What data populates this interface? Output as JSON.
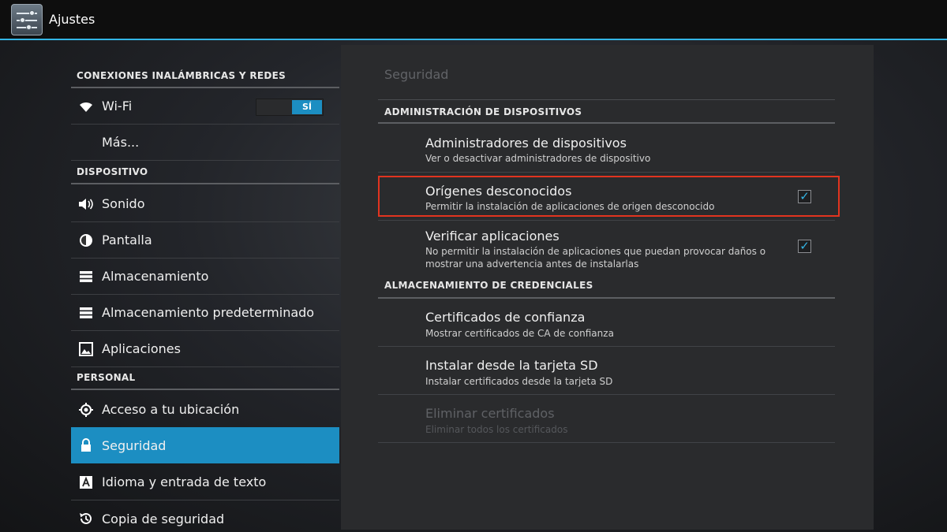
{
  "action_bar": {
    "title": "Ajustes",
    "icon": "settings-sliders-icon"
  },
  "left": {
    "sections": [
      {
        "header": "CONEXIONES INALÁMBRICAS Y REDES"
      },
      {
        "header": "DISPOSITIVO"
      },
      {
        "header": "PERSONAL"
      }
    ],
    "items": [
      {
        "label": "Wi-Fi",
        "icon": "wifi-icon",
        "toggle": "SÍ"
      },
      {
        "label": "Más..."
      },
      {
        "label": "Sonido",
        "icon": "speaker-icon"
      },
      {
        "label": "Pantalla",
        "icon": "brightness-icon"
      },
      {
        "label": "Almacenamiento",
        "icon": "storage-icon"
      },
      {
        "label": "Almacenamiento predeterminado",
        "icon": "storage-icon"
      },
      {
        "label": "Aplicaciones",
        "icon": "apps-icon"
      },
      {
        "label": "Acceso a tu ubicación",
        "icon": "location-icon"
      },
      {
        "label": "Seguridad",
        "icon": "lock-icon",
        "selected": true
      },
      {
        "label": "Idioma y entrada de texto",
        "icon": "language-icon"
      },
      {
        "label": "Copia de seguridad",
        "icon": "backup-icon"
      }
    ]
  },
  "right": {
    "title": "Seguridad",
    "sections": [
      {
        "header": "ADMINISTRACIÓN DE DISPOSITIVOS"
      },
      {
        "header": "ALMACENAMIENTO DE CREDENCIALES"
      }
    ],
    "prefs": [
      {
        "title": "Administradores de dispositivos",
        "summary": "Ver o desactivar administradores de dispositivo"
      },
      {
        "title": "Orígenes desconocidos",
        "summary": "Permitir la instalación de aplicaciones de origen desconocido",
        "checked": true
      },
      {
        "title": "Verificar aplicaciones",
        "summary": "No permitir la instalación de aplicaciones que puedan provocar daños o mostrar una advertencia antes de instalarlas",
        "checked": true
      },
      {
        "title": "Certificados de confianza",
        "summary": "Mostrar certificados de CA de confianza"
      },
      {
        "title": "Instalar desde la tarjeta SD",
        "summary": "Instalar certificados desde la tarjeta SD"
      },
      {
        "title": "Eliminar certificados",
        "summary": "Eliminar todos los certificados",
        "disabled": true
      }
    ]
  },
  "colors": {
    "accent": "#33b5e5",
    "selected": "#1c8ec2",
    "highlight": "#e2341f"
  }
}
